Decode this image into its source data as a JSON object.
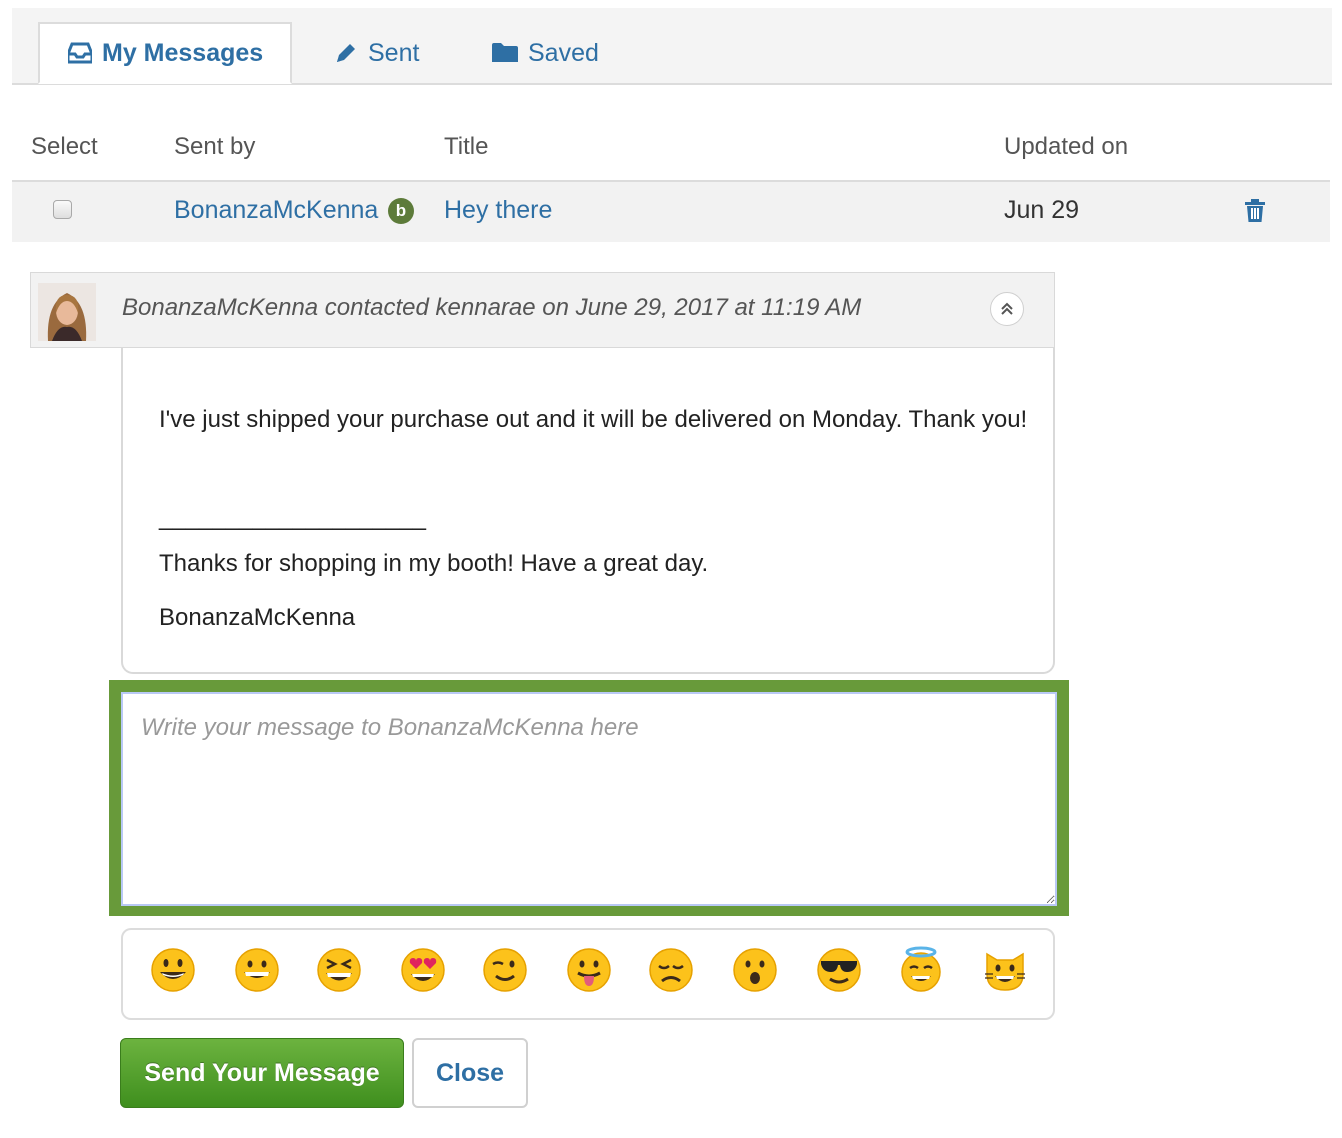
{
  "tabs": [
    {
      "label": "My Messages",
      "icon": "inbox-icon",
      "active": true
    },
    {
      "label": "Sent",
      "icon": "pencil-icon",
      "active": false
    },
    {
      "label": "Saved",
      "icon": "folder-icon",
      "active": false
    }
  ],
  "table": {
    "headers": [
      "Select",
      "Sent by",
      "Title",
      "Updated on"
    ],
    "rows": [
      {
        "sent_by": "BonanzaMcKenna",
        "seller_badge": "b",
        "title": "Hey there",
        "updated_on": "Jun 29",
        "checked": false
      }
    ]
  },
  "message": {
    "meta": "BonanzaMcKenna contacted kennarae on June 29, 2017 at 11:19 AM",
    "body_line1": "I've just shipped your purchase out and it will be delivered on Monday. Thank you!",
    "divider": "____________________",
    "signature_line": "Thanks for shopping in my booth! Have a great day.",
    "signature_name": "BonanzaMcKenna"
  },
  "reply": {
    "placeholder": "Write your message to BonanzaMcKenna here",
    "value": ""
  },
  "emojis": [
    "smiley",
    "grinning",
    "laughing",
    "heart-eyes",
    "wink",
    "tongue",
    "disappointed",
    "hushed",
    "sunglasses",
    "innocent",
    "smiley-cat"
  ],
  "buttons": {
    "send": "Send Your Message",
    "close": "Close"
  },
  "colors": {
    "link": "#2e6fa4",
    "highlight": "#689a3a",
    "send_button": "#4d9e2a",
    "seller_badge": "#5d7b3a"
  }
}
